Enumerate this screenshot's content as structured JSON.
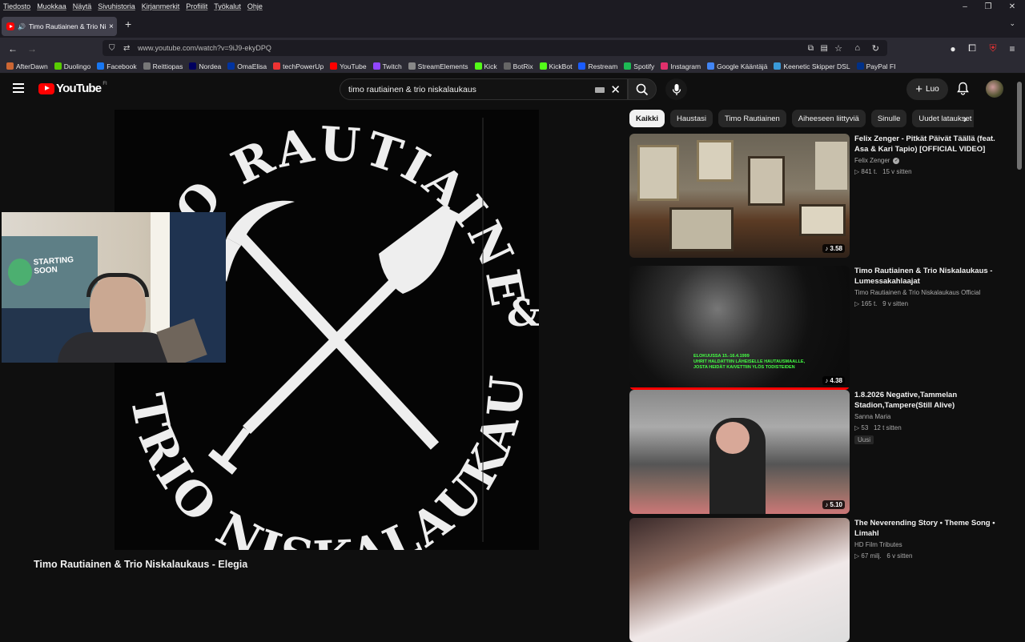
{
  "browser": {
    "menu": [
      "Tiedosto",
      "Muokkaa",
      "Näytä",
      "Sivuhistoria",
      "Kirjanmerkit",
      "Profiilit",
      "Työkalut",
      "Ohje"
    ],
    "tab_title": "Timo Rautiainen & Trio Nis",
    "url": "www.youtube.com/watch?v=9iJ9-ekyDPQ",
    "bookmarks": [
      {
        "label": "AfterDawn",
        "color": "#c63"
      },
      {
        "label": "Duolingo",
        "color": "#58cc02"
      },
      {
        "label": "Facebook",
        "color": "#1877f2"
      },
      {
        "label": "Reittiopas",
        "color": "#777"
      },
      {
        "label": "Nordea",
        "color": "#00005e"
      },
      {
        "label": "OmaElisa",
        "color": "#0033a0"
      },
      {
        "label": "techPowerUp",
        "color": "#e33"
      },
      {
        "label": "YouTube",
        "color": "#f00"
      },
      {
        "label": "Twitch",
        "color": "#9146ff"
      },
      {
        "label": "StreamElements",
        "color": "#888"
      },
      {
        "label": "Kick",
        "color": "#53fc18"
      },
      {
        "label": "BotRix",
        "color": "#666"
      },
      {
        "label": "KickBot",
        "color": "#53fc18"
      },
      {
        "label": "Restream",
        "color": "#1a5cff"
      },
      {
        "label": "Spotify",
        "color": "#1db954"
      },
      {
        "label": "Instagram",
        "color": "#e1306c"
      },
      {
        "label": "Google Kääntäjä",
        "color": "#4285f4"
      },
      {
        "label": "Keenetic Skipper DSL",
        "color": "#3a9ad9"
      },
      {
        "label": "PayPal FI",
        "color": "#003087"
      }
    ]
  },
  "youtube": {
    "logo_text": "YouTube",
    "region": "FI",
    "search_query": "timo rautiainen & trio niskalaukaus",
    "create_label": "Luo",
    "video_title": "Timo Rautiainen & Trio Niskalaukaus - Elegia",
    "chips": [
      "Kaikki",
      "Haustasi",
      "Timo Rautiainen",
      "Aiheeseen liittyviä",
      "Sinulle",
      "Uudet lataukset"
    ],
    "recommendations": [
      {
        "title": "Felix Zenger - Pitkät Päivät Täällä (feat. Asa & Kari Tapio) [OFFICIAL VIDEO]",
        "channel": "Felix Zenger",
        "verified": true,
        "views": "▷ 841 t.",
        "age": "15 v sitten",
        "duration": "♪ 3.58",
        "badge": ""
      },
      {
        "title": "Timo Rautiainen & Trio Niskalaukaus - Lumessakahlaajat",
        "channel": "Timo Rautiainen & Trio Niskalaukaus Official",
        "verified": false,
        "views": "▷ 165 t.",
        "age": "9 v sitten",
        "duration": "♪ 4.38",
        "badge": ""
      },
      {
        "title": "1.8.2026 Negative,Tammelan Stadion,Tampere(Still Alive)",
        "channel": "Sanna Maria",
        "verified": false,
        "views": "▷ 53",
        "age": "12 t sitten",
        "duration": "♪ 5.10",
        "badge": "Uusi"
      },
      {
        "title": "The Neverending Story • Theme Song • Limahl",
        "channel": "HD Film Tributes",
        "verified": false,
        "views": "▷ 67 milj.",
        "age": "6 v sitten",
        "duration": "",
        "badge": ""
      }
    ]
  },
  "video_art": {
    "top_text": "TIMO RAUTIAINEN",
    "bottom_text": "TRIO NISKALAUKAUS",
    "ampersand": "&"
  },
  "thumb2_caption": [
    "ELOKUUSSA 15.-16.4.1999",
    "UHRIT HALDATTIIN LÄHEISELLE HAUTAUSMAALLE,",
    "JOSTA HEIDÄT KAIVETTIIN YLÖS TODISTEIDEN"
  ],
  "webcam_poster": [
    "STARTING",
    "SOON"
  ]
}
